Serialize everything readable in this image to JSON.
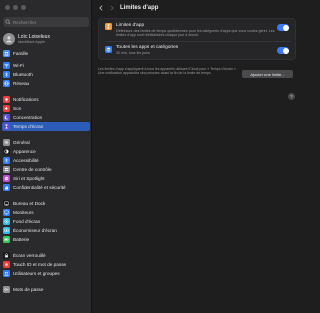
{
  "search": {
    "placeholder": "Rechercher"
  },
  "account": {
    "name": "Loïc Loiseleux",
    "subtitle": "Identifiant Apple"
  },
  "family": {
    "label": "Famille"
  },
  "sidebar": {
    "items": [
      {
        "label": "Wi-Fi",
        "icon": "wifi-icon",
        "color": "#2f7cf6"
      },
      {
        "label": "Bluetooth",
        "icon": "bluetooth-icon",
        "color": "#2f7cf6"
      },
      {
        "label": "Réseau",
        "icon": "globe-icon",
        "color": "#2f7cf6"
      },
      {
        "label": "Notifications",
        "icon": "bell-icon",
        "color": "#ef3b3b"
      },
      {
        "label": "Son",
        "icon": "speaker-icon",
        "color": "#ef3b3b"
      },
      {
        "label": "Concentration",
        "icon": "moon-icon",
        "color": "#5b4fd9"
      },
      {
        "label": "Temps d'écran",
        "icon": "hourglass-icon",
        "color": "#5b4fd9",
        "selected": true
      },
      {
        "label": "Général",
        "icon": "gear-icon",
        "color": "#8e8e93"
      },
      {
        "label": "Apparence",
        "icon": "appearance-icon",
        "color": "#1c1c1e"
      },
      {
        "label": "Accessibilité",
        "icon": "accessibility-icon",
        "color": "#2f7cf6"
      },
      {
        "label": "Centre de contrôle",
        "icon": "control-center-icon",
        "color": "#8e8e93"
      },
      {
        "label": "Siri et Spotlight",
        "icon": "siri-icon",
        "color": "#c048d8"
      },
      {
        "label": "Confidentialité et sécurité",
        "icon": "hand-icon",
        "color": "#2f7cf6"
      },
      {
        "label": "Bureau et Dock",
        "icon": "dock-icon",
        "color": "#1c1c1e"
      },
      {
        "label": "Moniteurs",
        "icon": "display-icon",
        "color": "#2f7cf6"
      },
      {
        "label": "Fond d'écran",
        "icon": "wallpaper-icon",
        "color": "#2fb7e6"
      },
      {
        "label": "Économiseur d'écran",
        "icon": "screensaver-icon",
        "color": "#2fb7e6"
      },
      {
        "label": "Batterie",
        "icon": "battery-icon",
        "color": "#34c759"
      },
      {
        "label": "Écran verrouillé",
        "icon": "lock-icon",
        "color": "#1c1c1e"
      },
      {
        "label": "Touch ID et mot de passe",
        "icon": "fingerprint-icon",
        "color": "#ef3b3b"
      },
      {
        "label": "Utilisateurs et groupes",
        "icon": "users-icon",
        "color": "#2f7cf6"
      },
      {
        "label": "Mots de passe",
        "icon": "key-icon",
        "color": "#8e8e93"
      }
    ]
  },
  "header": {
    "title": "Limites d'app"
  },
  "limits": {
    "title": "Limites d'app",
    "description": "Définissez des limites de temps quotidiennes pour les catégories d'apps que vous voulez gérer. Les limites d'app sont réinitialisées chaque jour à minuit.",
    "enabled": true,
    "icon_color": "#f29a38"
  },
  "all_apps": {
    "title": "Toutes les apps et catégories",
    "subtitle": "30 min, tous les jours",
    "enabled": true,
    "icon_color": "#2f7cf6"
  },
  "footer": {
    "text": "Les limites d'app s'appliquent à tous les appareils utilisant iCloud pour « Temps d'écran ». Une notification apparaîtra cinq minutes avant la fin de la limite de temps."
  },
  "add_button": {
    "label": "Ajouter une limite..."
  },
  "help": {
    "label": "?"
  }
}
